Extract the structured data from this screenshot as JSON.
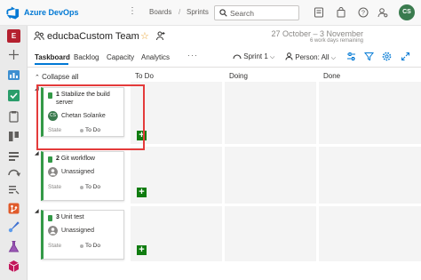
{
  "topbar": {
    "brand": "Azure DevOps",
    "breadcrumbs": [
      "Boards",
      "Sprints"
    ],
    "search_placeholder": "Search",
    "user_initials": "CS",
    "icons": [
      "azure-devops-logo",
      "more-icon",
      "search-icon",
      "task-list-icon",
      "shopping-bag-icon",
      "help-icon",
      "user-settings-icon"
    ]
  },
  "rail": {
    "project_initial": "E",
    "items": [
      "add-icon",
      "overview-icon",
      "boards-icon",
      "work-items-icon",
      "board-icon",
      "backlogs-icon",
      "sprints-icon",
      "queries-icon",
      "repos-icon",
      "pipelines-icon",
      "test-plans-icon",
      "artifacts-icon"
    ]
  },
  "header": {
    "team_name": "educbaCustom Team",
    "date_range": "27 October – 3 November",
    "work_days": "6 work days remaining"
  },
  "tabs": [
    "Taskboard",
    "Backlog",
    "Capacity",
    "Analytics"
  ],
  "controls": {
    "more": "···",
    "sprint": "Sprint 1",
    "person": "Person: All"
  },
  "board": {
    "collapse_all": "Collapse all",
    "columns": [
      "To Do",
      "Doing",
      "Done"
    ],
    "state_label": "State",
    "rows": [
      {
        "id": "1",
        "title": "Stabilize the build server",
        "assignee": "Chetan Solanke",
        "assignee_initials": "CS",
        "state": "To Do"
      },
      {
        "id": "2",
        "title": "Git workflow",
        "assignee": "Unassigned",
        "assignee_initials": "",
        "state": "To Do"
      },
      {
        "id": "3",
        "title": "Unit test",
        "assignee": "Unassigned",
        "assignee_initials": "",
        "state": "To Do"
      }
    ]
  },
  "colors": {
    "accent": "#0078d4",
    "story_green": "#339947",
    "add_green": "#107c10",
    "highlight_red": "#e43b3b"
  }
}
